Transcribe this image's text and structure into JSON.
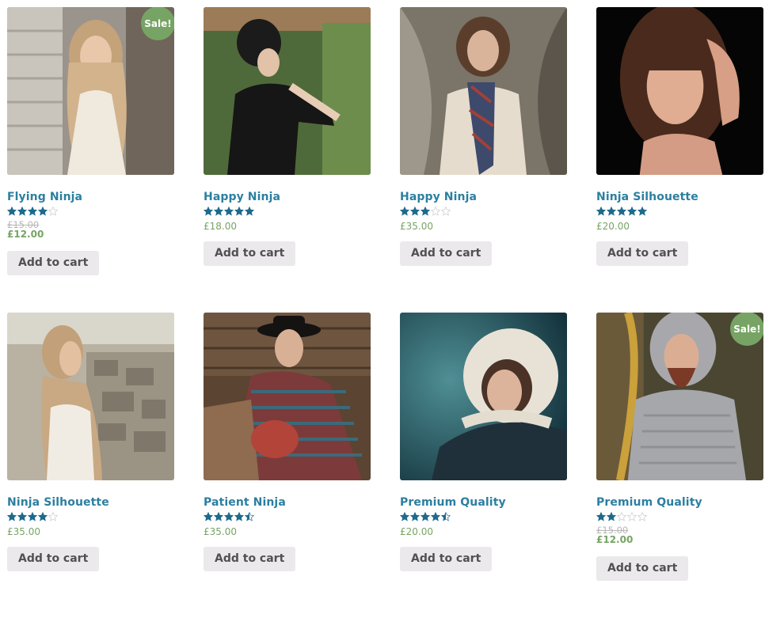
{
  "colors": {
    "title": "#2c7fa0",
    "price": "#77a464",
    "sale_badge": "#77a464",
    "button_bg": "#ebe9eb",
    "star": "#1d6a8c"
  },
  "products": [
    {
      "title": "Flying Ninja",
      "rating": 4,
      "price": "£12.00",
      "old_price": "£15.00",
      "sale_label": "Sale!",
      "button": "Add to cart"
    },
    {
      "title": "Happy Ninja",
      "rating": 5,
      "price": "£18.00",
      "button": "Add to cart"
    },
    {
      "title": "Happy Ninja",
      "rating": 3,
      "price": "£35.00",
      "button": "Add to cart"
    },
    {
      "title": "Ninja Silhouette",
      "rating": 5,
      "price": "£20.00",
      "button": "Add to cart"
    },
    {
      "title": "Ninja Silhouette",
      "rating": 4,
      "price": "£35.00",
      "button": "Add to cart"
    },
    {
      "title": "Patient Ninja",
      "rating": 4.5,
      "price": "£35.00",
      "button": "Add to cart"
    },
    {
      "title": "Premium Quality",
      "rating": 4.5,
      "price": "£20.00",
      "button": "Add to cart"
    },
    {
      "title": "Premium Quality",
      "rating": 2,
      "price": "£12.00",
      "old_price": "£15.00",
      "sale_label": "Sale!",
      "button": "Add to cart"
    }
  ]
}
